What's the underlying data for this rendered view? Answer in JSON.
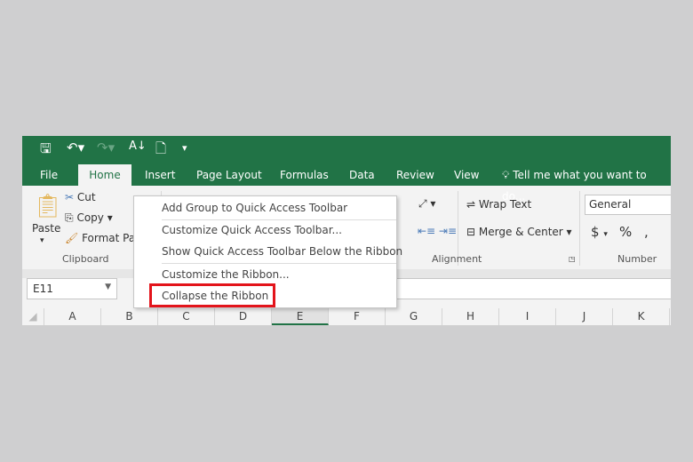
{
  "qat": {
    "icons": [
      "save-icon",
      "undo-icon",
      "redo-icon",
      "sort-icon",
      "new-document-icon",
      "customize-qat-icon"
    ]
  },
  "tabs": [
    "File",
    "Home",
    "Insert",
    "Page Layout",
    "Formulas",
    "Data",
    "Review",
    "View"
  ],
  "active_tab": "Home",
  "tell_me": "Tell me what you want to do...",
  "ribbon": {
    "paste": "Paste",
    "cut": "Cut",
    "copy": "Copy",
    "format_painter": "Format Pai",
    "clipboard": "Clipboard",
    "wrap_text": "Wrap Text",
    "merge_center": "Merge & Center",
    "alignment": "Alignment",
    "number_format": "General",
    "number": "Number",
    "currency": "$",
    "percent": "%",
    "comma": ","
  },
  "name_box": "E11",
  "columns": [
    "A",
    "B",
    "C",
    "D",
    "E",
    "F",
    "G",
    "H",
    "I",
    "J",
    "K"
  ],
  "selected_column": "E",
  "context_menu": [
    "Add Group to Quick Access Toolbar",
    "Customize Quick Access Toolbar...",
    "Show Quick Access Toolbar Below the Ribbon",
    "Customize the Ribbon...",
    "Collapse the Ribbon"
  ],
  "highlighted_item": "Collapse the Ribbon",
  "colors": {
    "brand": "#217346",
    "highlight": "#e3141b"
  }
}
